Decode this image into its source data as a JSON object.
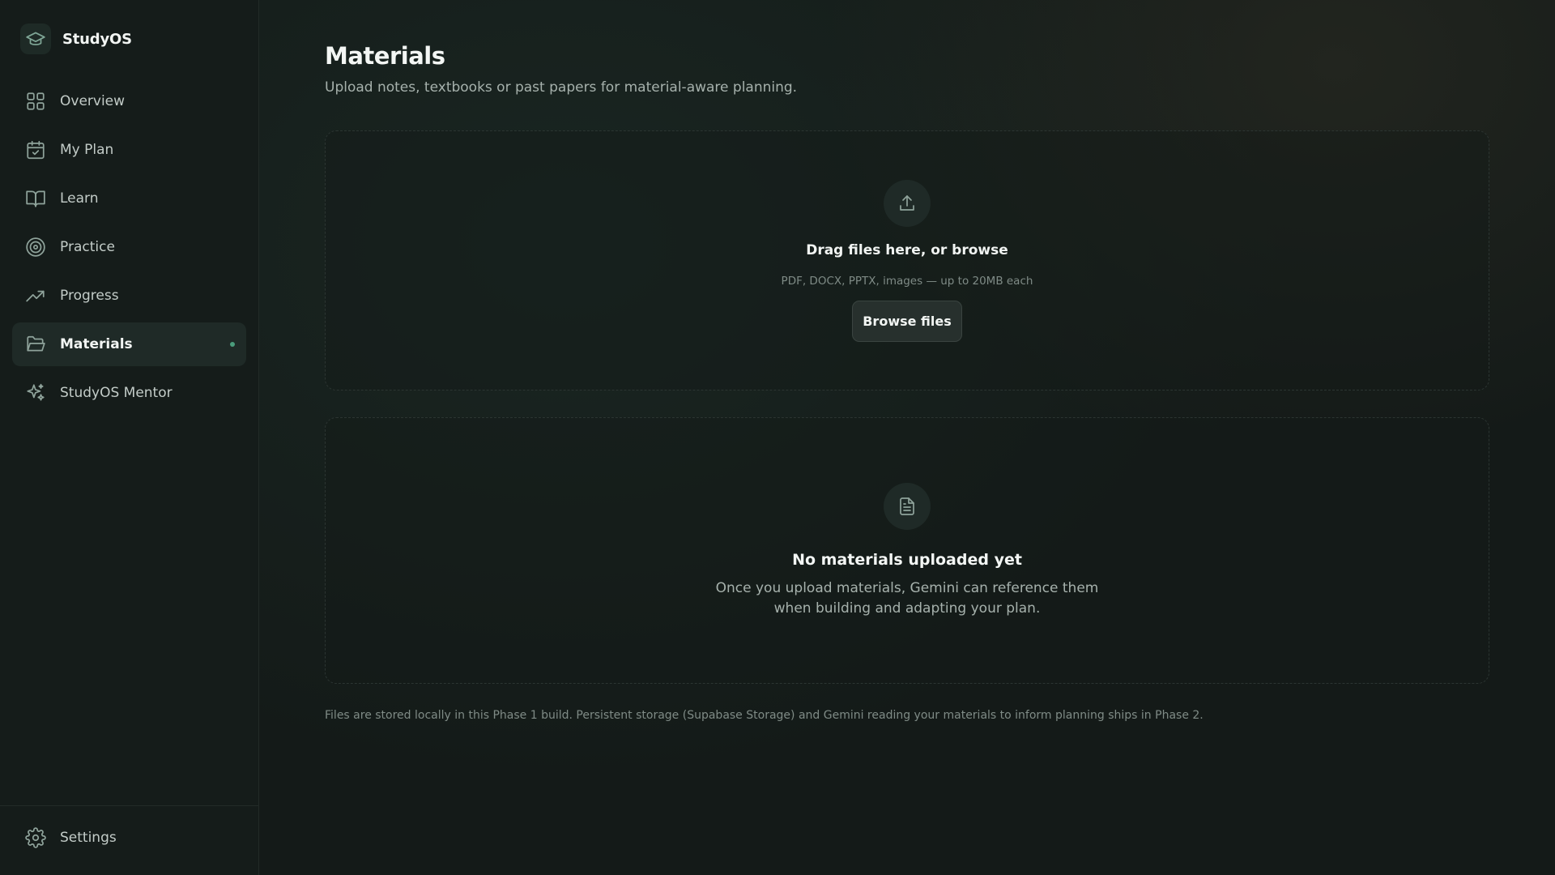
{
  "brand": {
    "name": "StudyOS"
  },
  "sidebar": {
    "items": [
      {
        "label": "Overview",
        "icon": "grid-icon",
        "active": false
      },
      {
        "label": "My Plan",
        "icon": "calendar-check-icon",
        "active": false
      },
      {
        "label": "Learn",
        "icon": "book-open-icon",
        "active": false
      },
      {
        "label": "Practice",
        "icon": "target-icon",
        "active": false
      },
      {
        "label": "Progress",
        "icon": "trending-up-icon",
        "active": false
      },
      {
        "label": "Materials",
        "icon": "folder-open-icon",
        "active": true
      },
      {
        "label": "StudyOS Mentor",
        "icon": "sparkles-icon",
        "active": false
      }
    ],
    "footer": {
      "label": "Settings",
      "icon": "gear-icon"
    }
  },
  "main": {
    "title": "Materials",
    "subtitle": "Upload notes, textbooks or past papers for material-aware planning.",
    "dropzone": {
      "icon": "upload-icon",
      "title": "Drag files here, or browse",
      "hint": "PDF, DOCX, PPTX, images — up to 20MB each",
      "button_label": "Browse files"
    },
    "empty_state": {
      "icon": "file-text-icon",
      "title": "No materials uploaded yet",
      "description": "Once you upload materials, Gemini can reference them when building and adapting your plan."
    },
    "footnote": "Files are stored locally in this Phase 1 build. Persistent storage (Supabase Storage) and Gemini reading your materials to inform planning ships in Phase 2."
  },
  "colors": {
    "background": "#141a18",
    "sidebar": "#151c1a",
    "accent": "#4a9c7c",
    "active_item": "#1f2a27",
    "text_primary": "#f2f5f3",
    "text_secondary": "#a6b1ac",
    "icon": "#8fa39b"
  }
}
